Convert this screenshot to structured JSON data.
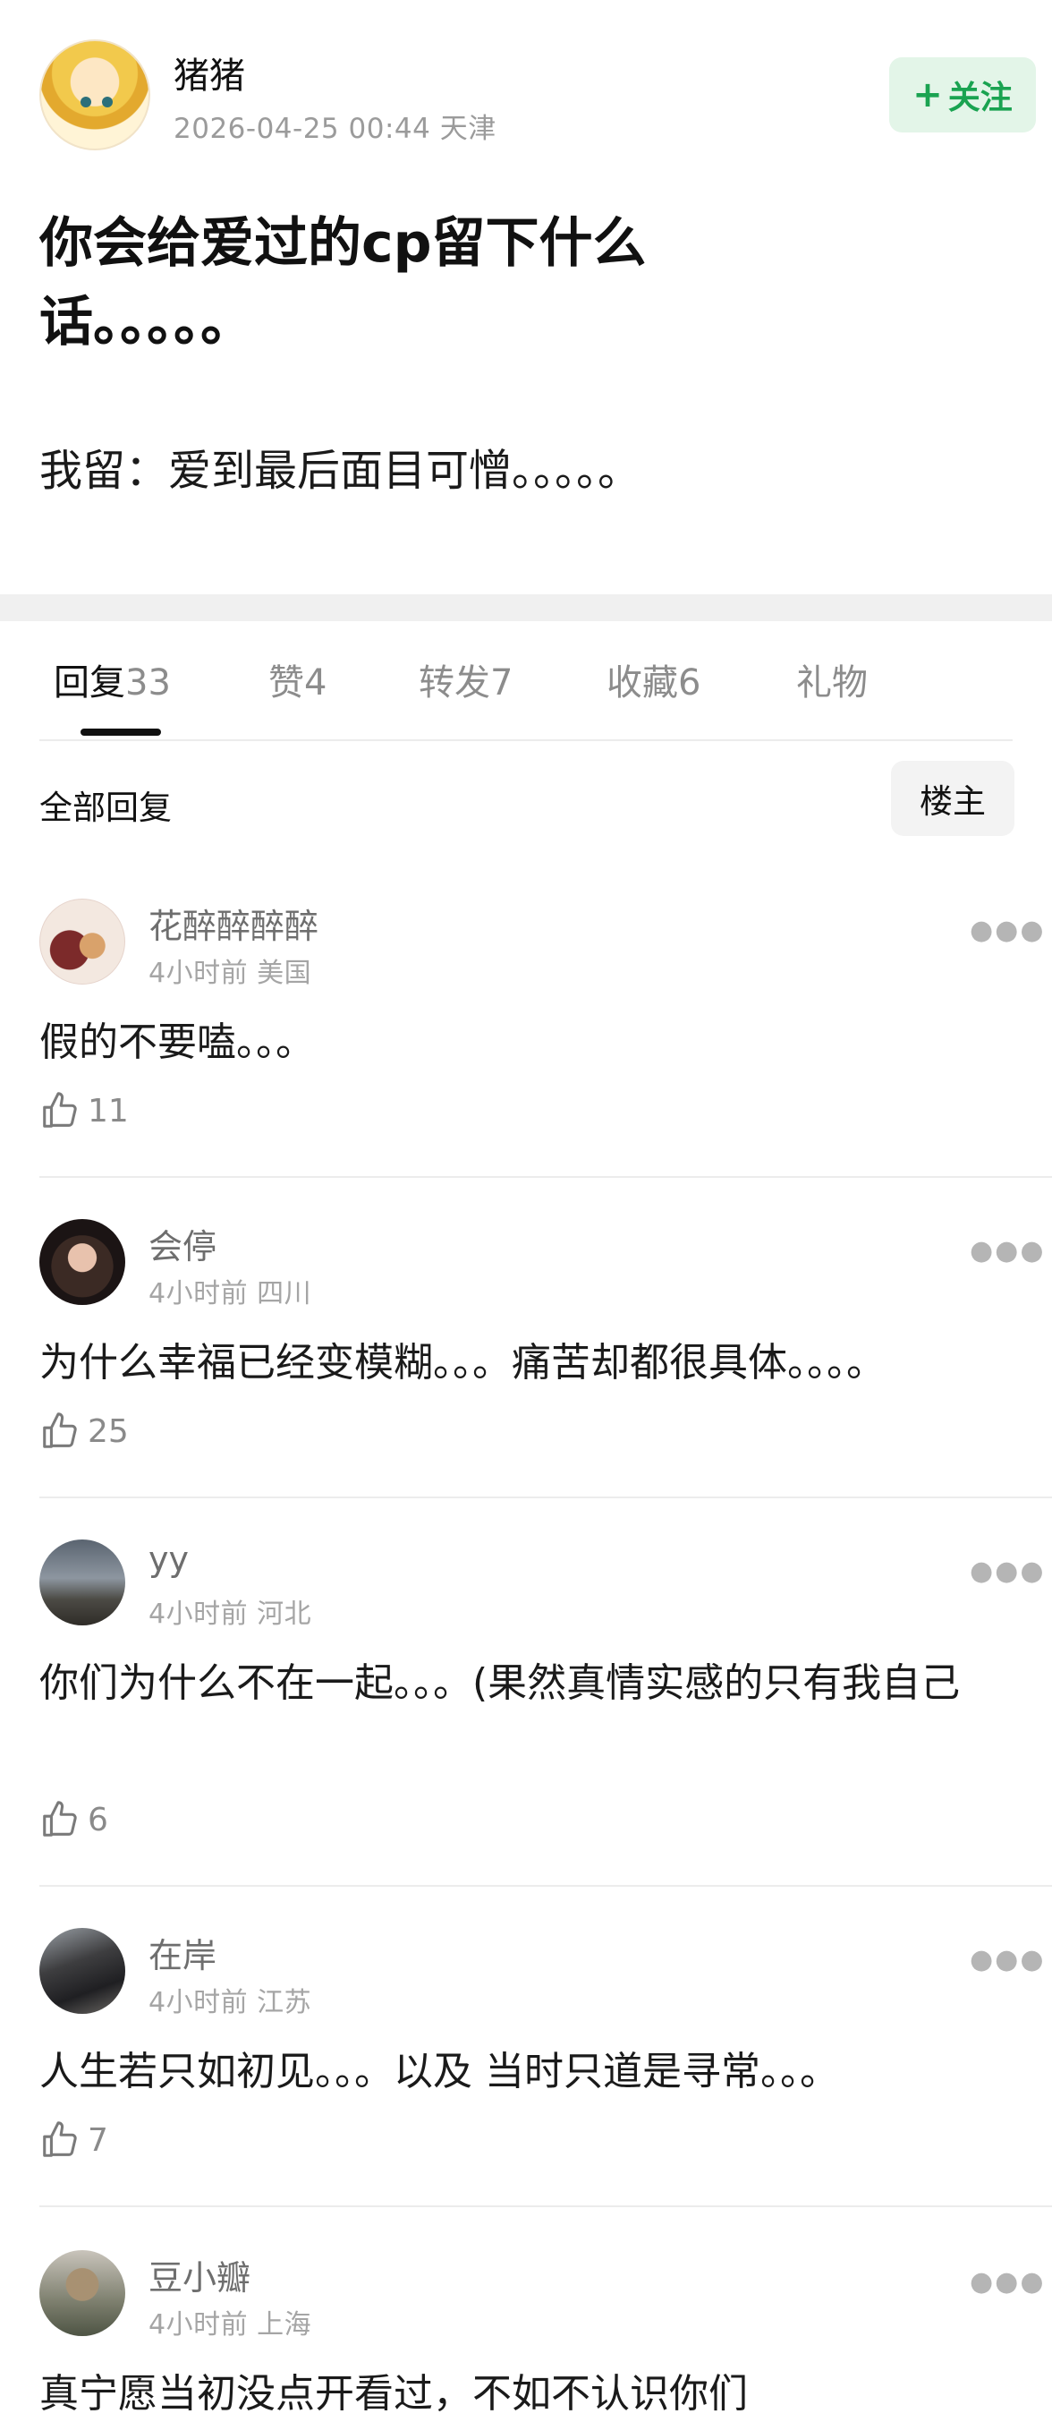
{
  "post": {
    "author": "猪猪",
    "meta": "2026-04-25 00:44  天津",
    "follow_label": "关注",
    "title": "你会给爱过的cp留下什么话。。。。。",
    "body": "我留：爱到最后面目可憎。。。。。"
  },
  "tabs": [
    {
      "label": "回复",
      "count": "33",
      "active": true
    },
    {
      "label": "赞",
      "count": "4"
    },
    {
      "label": "转发",
      "count": "7"
    },
    {
      "label": "收藏",
      "count": "6"
    },
    {
      "label": "礼物",
      "count": ""
    }
  ],
  "section": {
    "title": "全部回复",
    "sort_label": "楼主"
  },
  "replies": [
    {
      "name": "花醉醉醉醉",
      "meta": "4小时前 美国",
      "text": "假的不要嗑。。。",
      "likes": "11"
    },
    {
      "name": "会停",
      "meta": "4小时前 四川",
      "text": "为什么幸福已经变模糊。。。痛苦却都很具体。。。。",
      "likes": "25"
    },
    {
      "name": "yy",
      "meta": "4小时前 河北",
      "text": "你们为什么不在一起。。。(果然真情实感的只有我自己",
      "likes": "6"
    },
    {
      "name": "在岸",
      "meta": "4小时前 江苏",
      "text": "人生若只如初见。。。以及 当时只道是寻常。。。",
      "likes": "7"
    },
    {
      "name": "豆小瓣",
      "meta": "4小时前 上海",
      "text": "真宁愿当初没点开看过，不如不认识你们",
      "likes": ""
    }
  ],
  "icons": {
    "more": "more-dots-icon",
    "like": "thumbs-up-icon"
  },
  "colors": {
    "accent_green": "#1aa351",
    "follow_bg": "#e3f5e8",
    "divider": "#f0f0f0"
  }
}
